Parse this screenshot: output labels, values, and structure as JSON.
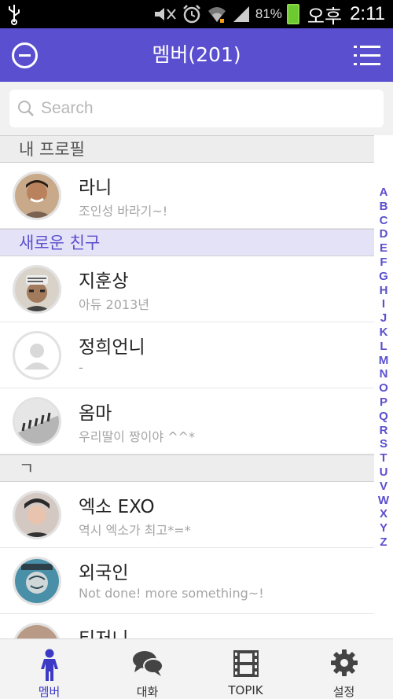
{
  "status_bar": {
    "battery": "81%",
    "ampm": "오후",
    "time": "2:11"
  },
  "header": {
    "title": "멤버(201)",
    "left_icon": "minus-circle-icon",
    "right_icon": "list-menu-icon"
  },
  "search": {
    "placeholder": "Search"
  },
  "sections": {
    "my_profile": "내 프로필",
    "new_friends": "새로운 친구",
    "giyeok": "ㄱ"
  },
  "contacts": {
    "me": {
      "name": "라니",
      "status": "조인성 바라기~!"
    },
    "new1": {
      "name": "지훈상",
      "status": "아듀 2013년"
    },
    "new2": {
      "name": "정희언니",
      "status": "-"
    },
    "new3": {
      "name": "옴마",
      "status": "우리딸이 짱이야 ^^*"
    },
    "g1": {
      "name": "엑소 EXO",
      "status": "역시 엑소가 최고*=*"
    },
    "g2": {
      "name": "외국인",
      "status": "Not done! more something~!"
    },
    "g3": {
      "name": "티저니",
      "status": ""
    }
  },
  "index_letters": [
    "A",
    "B",
    "C",
    "D",
    "E",
    "F",
    "G",
    "H",
    "I",
    "J",
    "K",
    "L",
    "M",
    "N",
    "O",
    "P",
    "Q",
    "R",
    "S",
    "T",
    "U",
    "V",
    "W",
    "X",
    "Y",
    "Z"
  ],
  "tabs": {
    "members": "멤버",
    "chat": "대화",
    "topik": "TOPIK",
    "settings": "설정"
  },
  "colors": {
    "accent": "#5a4fcf",
    "active_tab": "#3c39c4"
  }
}
